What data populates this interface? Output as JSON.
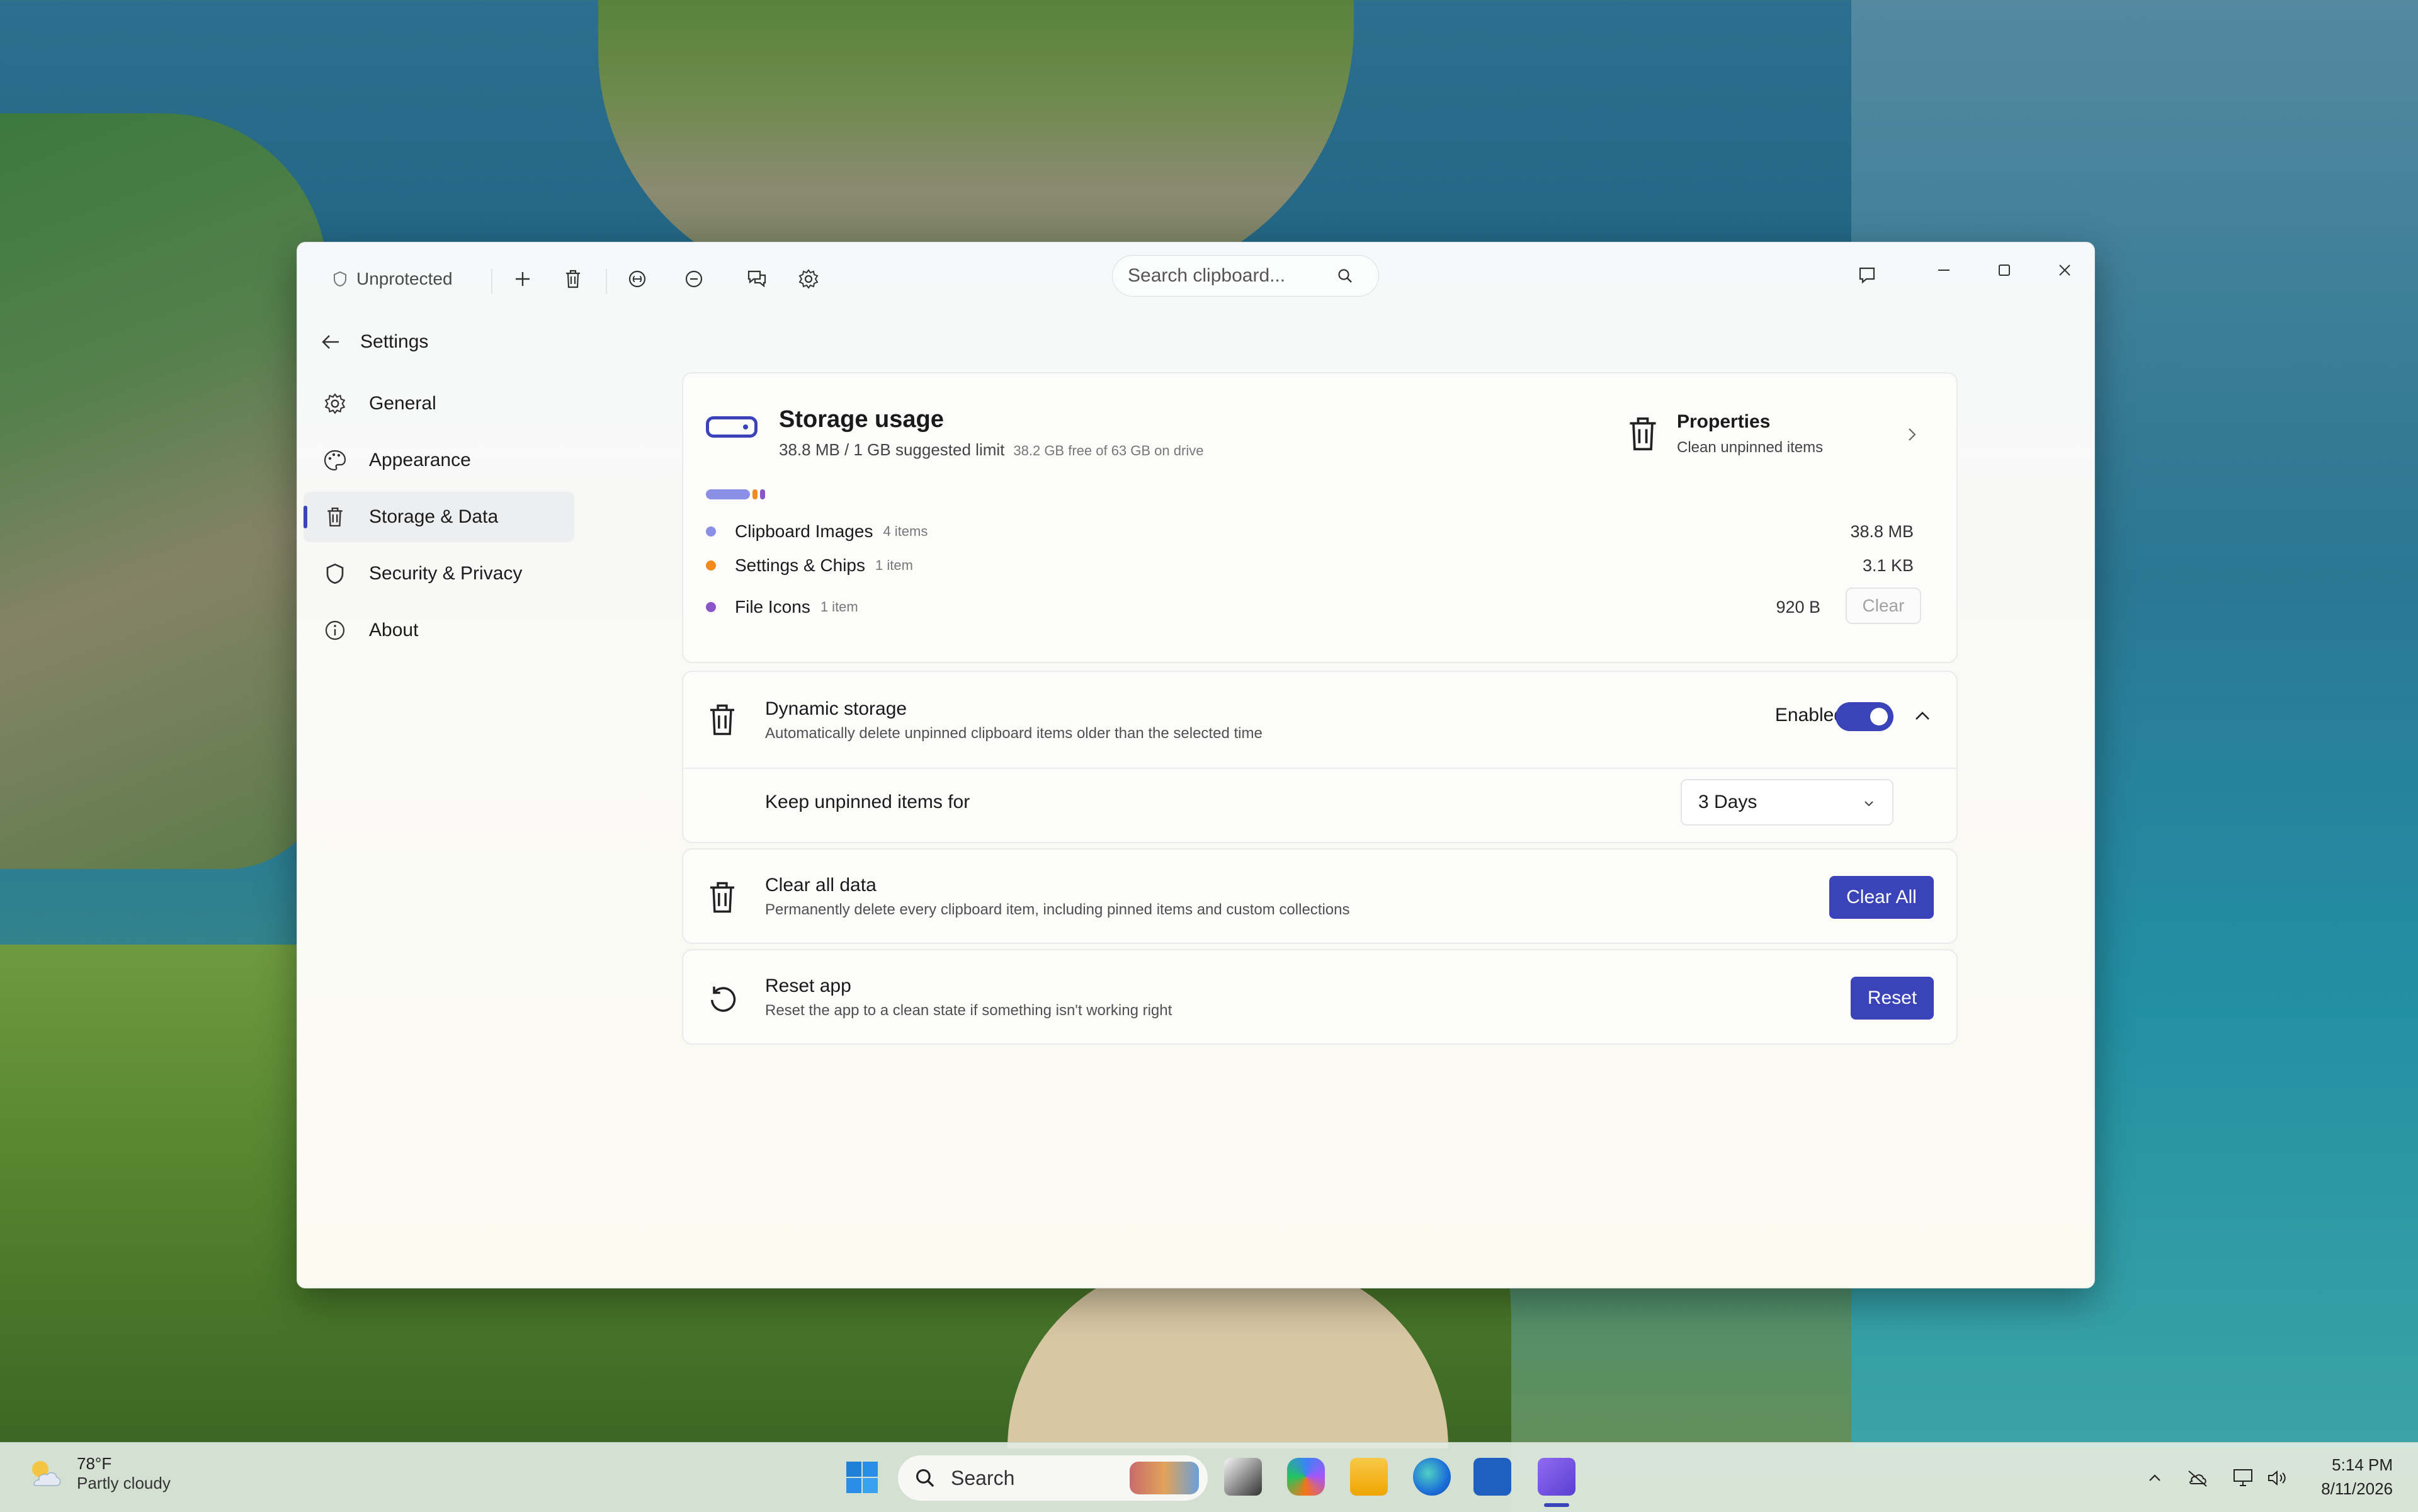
{
  "window": {
    "protection_status": "Unprotected",
    "search_placeholder": "Search clipboard..."
  },
  "sidebar": {
    "back_title": "Settings",
    "items": [
      {
        "label": "General",
        "icon": "gear-icon"
      },
      {
        "label": "Appearance",
        "icon": "palette-icon"
      },
      {
        "label": "Storage & Data",
        "icon": "trash-icon",
        "active": true
      },
      {
        "label": "Security & Privacy",
        "icon": "shield-icon"
      },
      {
        "label": "About",
        "icon": "info-icon"
      }
    ]
  },
  "storage": {
    "title": "Storage usage",
    "usage": "38.8 MB / 1 GB suggested limit",
    "drive_free": "38.2 GB free of 63 GB on drive",
    "properties_title": "Properties",
    "properties_sub": "Clean unpinned items",
    "categories": [
      {
        "name": "Clipboard Images",
        "count": "4 items",
        "size": "38.8 MB",
        "color": "#8b8fe6"
      },
      {
        "name": "Settings & Chips",
        "count": "1 item",
        "size": "3.1 KB",
        "color": "#f28a1c"
      },
      {
        "name": "File Icons",
        "count": "1 item",
        "size": "920 B",
        "color": "#8a55c9"
      }
    ],
    "clear_label": "Clear"
  },
  "dynamic": {
    "title": "Dynamic storage",
    "desc": "Automatically delete unpinned clipboard items older than the selected time",
    "status": "Enabled",
    "enabled": true,
    "keep_label": "Keep unpinned items for",
    "keep_value": "3 Days"
  },
  "clear_all": {
    "title": "Clear all data",
    "desc": "Permanently delete every clipboard item, including pinned items and custom collections",
    "button": "Clear All"
  },
  "reset": {
    "title": "Reset app",
    "desc": "Reset the app to a clean state if something isn't working right",
    "button": "Reset"
  },
  "taskbar": {
    "temp": "78°F",
    "condition": "Partly cloudy",
    "search": "Search",
    "time": "5:14 PM",
    "date": "8/11/2026"
  },
  "colors": {
    "accent": "#3a43b8"
  }
}
